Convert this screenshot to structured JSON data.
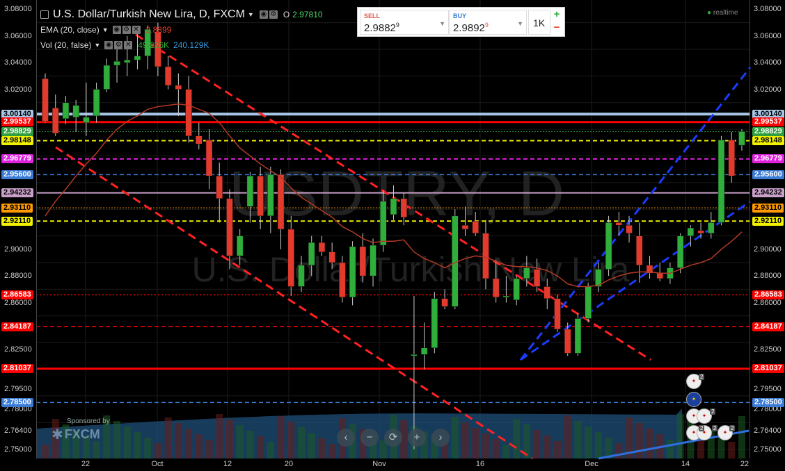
{
  "legend": {
    "title": "U.S. Dollar/Turkish New Lira, D, FXCM",
    "ohlc_label": "O",
    "ohlc_value": "2.97810",
    "ema_label": "EMA (20, close)",
    "ema_value": "2.8899",
    "vol_label": "Vol (20, false)",
    "vol_value1": "49.226K",
    "vol_value2": "240.129K"
  },
  "trade": {
    "sell_label": "SELL",
    "sell_main": "2.9882",
    "sell_sup": "9",
    "buy_label": "BUY",
    "buy_main": "2.9892",
    "buy_sup": "9",
    "qty": "1K",
    "plus": "+",
    "minus": "−"
  },
  "realtime_label": "realtime",
  "watermark_symbol": "USDTRY, D",
  "watermark_name": "U.S. Dollar/Turkish New Lira",
  "sponsor": {
    "label": "Sponsored by",
    "brand": "FXCM"
  },
  "axis_ticks": [
    "3.08000",
    "3.06000",
    "3.04000",
    "3.02000",
    "2.90000",
    "2.88000",
    "2.86000",
    "2.82500",
    "2.79500",
    "2.78000",
    "2.76400",
    "2.75000"
  ],
  "right_tags": [
    {
      "text": "3.00140",
      "bg": "#a8c7e8",
      "fg": "#000"
    },
    {
      "text": "2.99537",
      "bg": "#ff0000",
      "fg": "#fff"
    },
    {
      "text": "2.98829",
      "bg": "#2e9e3e",
      "fg": "#fff"
    },
    {
      "text": "2.98148",
      "bg": "#f1f100",
      "fg": "#000"
    },
    {
      "text": "2.96779",
      "bg": "#e022e0",
      "fg": "#fff"
    },
    {
      "text": "2.95600",
      "bg": "#3a7bd5",
      "fg": "#fff"
    },
    {
      "text": "2.94232",
      "bg": "#c9a0c9",
      "fg": "#000"
    },
    {
      "text": "2.93110",
      "bg": "#ff9900",
      "fg": "#000"
    },
    {
      "text": "2.92110",
      "bg": "#f1f100",
      "fg": "#000"
    },
    {
      "text": "2.86583",
      "bg": "#ff0000",
      "fg": "#fff"
    },
    {
      "text": "2.84187",
      "bg": "#ff0000",
      "fg": "#fff"
    },
    {
      "text": "2.81037",
      "bg": "#ff0000",
      "fg": "#fff"
    },
    {
      "text": "2.78500",
      "bg": "#3a7bd5",
      "fg": "#fff"
    }
  ],
  "x_labels": [
    "22",
    "Oct",
    "12",
    "20",
    "Nov",
    "16",
    "Dec",
    "14",
    "22"
  ],
  "nav_buttons": [
    "‹",
    "−",
    "⟳",
    "+",
    "›"
  ],
  "flag_counts": [
    "2",
    "2",
    "2",
    "2",
    "2"
  ],
  "colors": {
    "up": "#2fae3b",
    "down": "#e23b2e",
    "ema": "#b33a24"
  },
  "chart_data": {
    "type": "candlestick",
    "ylim": [
      2.743,
      3.087
    ],
    "candles": [
      [
        3.028,
        3.032,
        2.995,
        2.996
      ],
      [
        3.006,
        3.016,
        2.985,
        2.987
      ],
      [
        2.998,
        3.015,
        2.994,
        3.01
      ],
      [
        2.999,
        3.012,
        2.988,
        3.008
      ],
      [
        2.995,
        3.025,
        2.985,
        2.999
      ],
      [
        3.0,
        3.025,
        2.995,
        3.02
      ],
      [
        3.02,
        3.043,
        3.018,
        3.038
      ],
      [
        3.038,
        3.055,
        3.025,
        3.041
      ],
      [
        3.04,
        3.06,
        3.03,
        3.042
      ],
      [
        3.042,
        3.065,
        3.035,
        3.045
      ],
      [
        3.045,
        3.068,
        3.035,
        3.065
      ],
      [
        3.063,
        3.07,
        3.03,
        3.037
      ],
      [
        3.037,
        3.045,
        3.02,
        3.023
      ],
      [
        3.023,
        3.032,
        3.0,
        3.02
      ],
      [
        3.02,
        3.03,
        2.98,
        2.985
      ],
      [
        2.985,
        2.995,
        2.975,
        2.979
      ],
      [
        2.982,
        2.99,
        2.945,
        2.955
      ],
      [
        2.955,
        2.965,
        2.92,
        2.938
      ],
      [
        2.938,
        2.945,
        2.885,
        2.895
      ],
      [
        2.895,
        2.915,
        2.888,
        2.91
      ],
      [
        2.932,
        2.958,
        2.92,
        2.955
      ],
      [
        2.955,
        2.962,
        2.915,
        2.925
      ],
      [
        2.925,
        2.962,
        2.912,
        2.956
      ],
      [
        2.956,
        2.96,
        2.9,
        2.915
      ],
      [
        2.915,
        2.925,
        2.865,
        2.872
      ],
      [
        2.872,
        2.895,
        2.868,
        2.888
      ],
      [
        2.888,
        2.91,
        2.88,
        2.905
      ],
      [
        2.905,
        2.91,
        2.895,
        2.898
      ],
      [
        2.898,
        2.905,
        2.885,
        2.89
      ],
      [
        2.89,
        2.895,
        2.86,
        2.864
      ],
      [
        2.864,
        2.906,
        2.858,
        2.902
      ],
      [
        2.902,
        2.912,
        2.875,
        2.88
      ],
      [
        2.88,
        2.908,
        2.872,
        2.903
      ],
      [
        2.903,
        2.944,
        2.898,
        2.936
      ],
      [
        2.926,
        2.948,
        2.922,
        2.938
      ],
      [
        2.938,
        2.942,
        2.918,
        2.924
      ],
      [
        2.82,
        2.865,
        2.75,
        2.821
      ],
      [
        2.821,
        2.845,
        2.81,
        2.826
      ],
      [
        2.826,
        2.868,
        2.822,
        2.863
      ],
      [
        2.863,
        2.87,
        2.855,
        2.857
      ],
      [
        2.857,
        2.93,
        2.855,
        2.925
      ],
      [
        2.918,
        2.932,
        2.91,
        2.915
      ],
      [
        2.921,
        2.928,
        2.91,
        2.912
      ],
      [
        2.912,
        2.922,
        2.87,
        2.878
      ],
      [
        2.878,
        2.892,
        2.86,
        2.864
      ],
      [
        2.864,
        2.88,
        2.86,
        2.865
      ],
      [
        2.862,
        2.88,
        2.858,
        2.878
      ],
      [
        2.878,
        2.895,
        2.872,
        2.886
      ],
      [
        2.885,
        2.893,
        2.868,
        2.872
      ],
      [
        2.872,
        2.878,
        2.855,
        2.863
      ],
      [
        2.863,
        2.866,
        2.838,
        2.84
      ],
      [
        2.84,
        2.845,
        2.82,
        2.822
      ],
      [
        2.822,
        2.852,
        2.82,
        2.848
      ],
      [
        2.848,
        2.875,
        2.845,
        2.872
      ],
      [
        2.872,
        2.89,
        2.868,
        2.885
      ],
      [
        2.885,
        2.925,
        2.88,
        2.92
      ],
      [
        2.92,
        2.928,
        2.91,
        2.918
      ],
      [
        2.918,
        2.925,
        2.905,
        2.912
      ],
      [
        2.91,
        2.92,
        2.875,
        2.888
      ],
      [
        2.888,
        2.895,
        2.878,
        2.882
      ],
      [
        2.882,
        2.89,
        2.876,
        2.878
      ],
      [
        2.878,
        2.89,
        2.874,
        2.886
      ],
      [
        2.886,
        2.912,
        2.882,
        2.91
      ],
      [
        2.91,
        2.918,
        2.902,
        2.916
      ],
      [
        2.914,
        2.92,
        2.908,
        2.912
      ],
      [
        2.912,
        2.928,
        2.908,
        2.92
      ],
      [
        2.92,
        2.985,
        2.918,
        2.982
      ],
      [
        2.982,
        2.988,
        2.95,
        2.955
      ],
      [
        2.978,
        2.99,
        2.974,
        2.9883
      ]
    ],
    "ema": [
      2.925,
      2.936,
      2.945,
      2.955,
      2.964,
      2.972,
      2.982,
      2.99,
      2.996,
      3.0,
      3.005,
      3.007,
      3.008,
      3.009,
      3.008,
      3.005,
      3.002,
      2.995,
      2.985,
      2.976,
      2.97,
      2.964,
      2.959,
      2.954,
      2.946,
      2.939,
      2.934,
      2.929,
      2.924,
      2.917,
      2.913,
      2.908,
      2.905,
      2.906,
      2.906,
      2.907,
      2.898,
      2.893,
      2.89,
      2.886,
      2.89,
      2.893,
      2.895,
      2.894,
      2.891,
      2.888,
      2.887,
      2.887,
      2.886,
      2.884,
      2.88,
      2.874,
      2.872,
      2.872,
      2.873,
      2.877,
      2.88,
      2.882,
      2.883,
      2.883,
      2.882,
      2.882,
      2.885,
      2.888,
      2.89,
      2.893,
      2.9,
      2.906,
      2.913
    ]
  }
}
